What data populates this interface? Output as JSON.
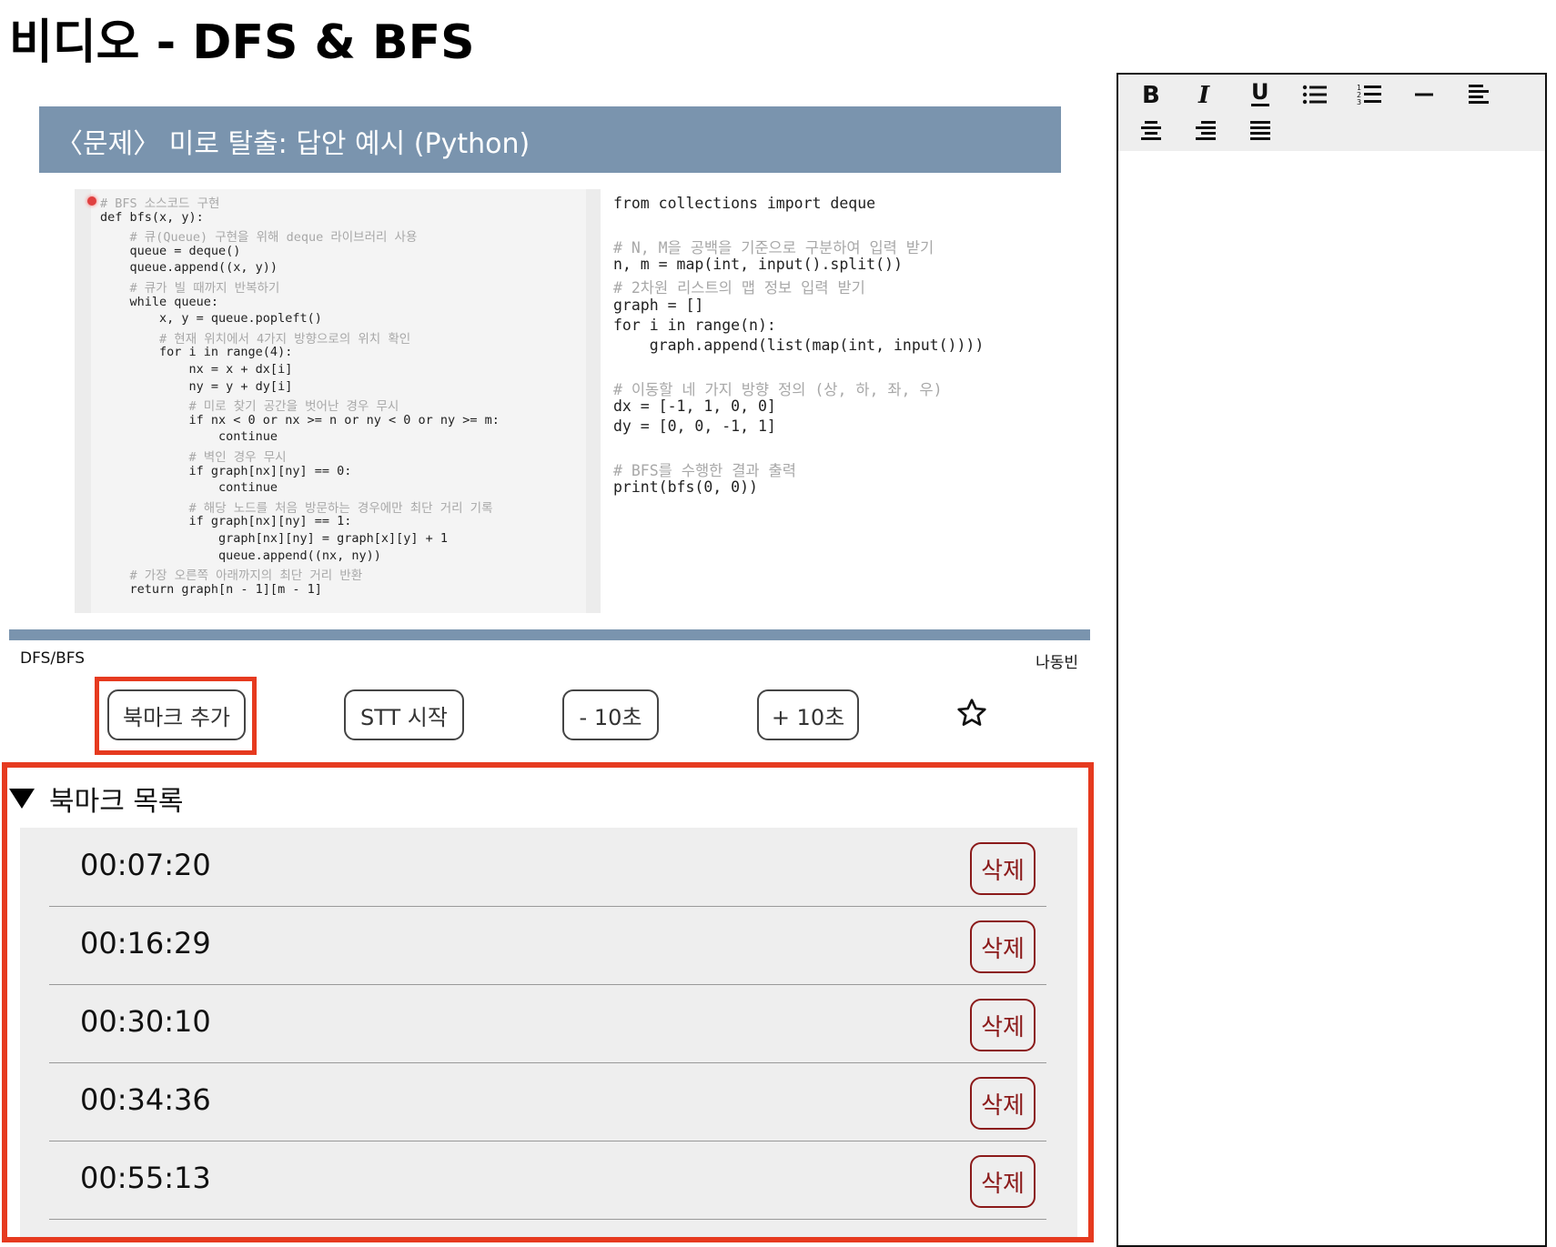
{
  "page_title": "비디오 - DFS & BFS",
  "video": {
    "slide_title": "〈문제〉 미로 탈출: 답안 예시 (Python)",
    "code_left": [
      "# BFS 소스코드 구현",
      "def bfs(x, y):",
      "    # 큐(Queue) 구현을 위해 deque 라이브러리 사용",
      "    queue = deque()",
      "    queue.append((x, y))",
      "    # 큐가 빌 때까지 반복하기",
      "    while queue:",
      "        x, y = queue.popleft()",
      "        # 현재 위치에서 4가지 방향으로의 위치 확인",
      "        for i in range(4):",
      "            nx = x + dx[i]",
      "            ny = y + dy[i]",
      "            # 미로 찾기 공간을 벗어난 경우 무시",
      "            if nx < 0 or nx >= n or ny < 0 or ny >= m:",
      "                continue",
      "            # 벽인 경우 무시",
      "            if graph[nx][ny] == 0:",
      "                continue",
      "            # 해당 노드를 처음 방문하는 경우에만 최단 거리 기록",
      "            if graph[nx][ny] == 1:",
      "                graph[nx][ny] = graph[x][y] + 1",
      "                queue.append((nx, ny))",
      "    # 가장 오른쪽 아래까지의 최단 거리 반환",
      "    return graph[n - 1][m - 1]"
    ],
    "code_right": [
      "from collections import deque",
      "",
      "# N, M을 공백을 기준으로 구분하여 입력 받기",
      "n, m = map(int, input().split())",
      "# 2차원 리스트의 맵 정보 입력 받기",
      "graph = []",
      "for i in range(n):",
      "    graph.append(list(map(int, input())))",
      "",
      "# 이동할 네 가지 방향 정의 (상, 하, 좌, 우)",
      "dx = [-1, 1, 0, 0]",
      "dy = [0, 0, -1, 1]",
      "",
      "# BFS를 수행한 결과 출력",
      "print(bfs(0, 0))"
    ],
    "category": "DFS/BFS",
    "author": "나동빈"
  },
  "controls": {
    "add_bookmark": "북마크 추가",
    "stt_start": "STT 시작",
    "rewind": "- 10초",
    "forward": "+ 10초",
    "star_icon": "star-outline"
  },
  "bookmarks": {
    "header": "북마크 목록",
    "delete_label": "삭제",
    "items": [
      {
        "time": "00:07:20"
      },
      {
        "time": "00:16:29"
      },
      {
        "time": "00:30:10"
      },
      {
        "time": "00:34:36"
      },
      {
        "time": "00:55:13"
      }
    ]
  },
  "editor": {
    "toolbar": [
      "bold",
      "italic",
      "underline",
      "bullet-list",
      "numbered-list",
      "horizontal-rule",
      "align-left",
      "align-center",
      "align-right",
      "align-justify"
    ]
  },
  "colors": {
    "highlight": "#e63a1f",
    "slide_banner": "#7a94ae",
    "delete_button": "#8b1a1a"
  }
}
